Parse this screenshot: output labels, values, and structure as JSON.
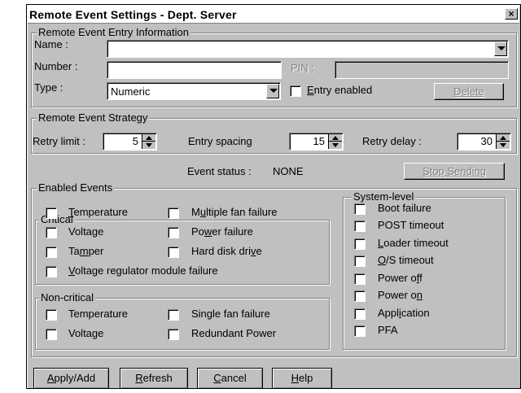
{
  "window": {
    "title": "Remote Event Settings - Dept. Server",
    "close_glyph": "×"
  },
  "entry": {
    "group_title": "Remote Event Entry Information",
    "name_label": "Name :",
    "name_value": "",
    "number_label": "Number :",
    "number_value": "",
    "pin_label": "PIN :",
    "pin_value": "",
    "type_label": "Type :",
    "type_value": "Numeric",
    "entry_enabled_pre": "",
    "entry_enabled_mn": "E",
    "entry_enabled_post": "ntry enabled",
    "entry_enabled_checked": false,
    "delete_label": "Delete"
  },
  "strategy": {
    "group_title": "Remote Event Strategy",
    "retry_limit_label": "Retry limit :",
    "retry_limit_value": "5",
    "entry_spacing_label": "Entry spacing",
    "entry_spacing_value": "15",
    "retry_delay_label": "Retry delay :",
    "retry_delay_value": "30"
  },
  "status": {
    "label": "Event status :",
    "value": "NONE",
    "stop_label": "Stop Sending"
  },
  "events": {
    "group_title": "Enabled Events",
    "critical": {
      "title": "Critical",
      "temperature": {
        "pre": "",
        "mn": "T",
        "post": "emperature",
        "checked": false
      },
      "voltage": {
        "pre": "Voltage",
        "mn": "",
        "post": "",
        "checked": false
      },
      "tamper": {
        "pre": "Ta",
        "mn": "m",
        "post": "per",
        "checked": false
      },
      "multiple_fan": {
        "pre": "M",
        "mn": "u",
        "post": "ltiple fan failure",
        "checked": false
      },
      "power_failure": {
        "pre": "Po",
        "mn": "w",
        "post": "er failure",
        "checked": false
      },
      "hard_disk": {
        "pre": "Hard disk dri",
        "mn": "v",
        "post": "e",
        "checked": false
      },
      "vrm": {
        "pre": "",
        "mn": "V",
        "post": "oltage regulator module failure",
        "checked": false
      }
    },
    "non_critical": {
      "title": "Non-critical",
      "temperature": {
        "label": "Temperature",
        "checked": false
      },
      "voltage": {
        "label": "Voltage",
        "checked": false
      },
      "single_fan": {
        "label": "Single fan failure",
        "checked": false
      },
      "redundant_power": {
        "label": "Redundant Power",
        "checked": false
      }
    },
    "system_level": {
      "title": "System-level",
      "boot_failure": {
        "pre": "Boot failure",
        "mn": "",
        "post": "",
        "checked": false
      },
      "post_timeout": {
        "pre": "POST timeout",
        "mn": "",
        "post": "",
        "checked": false
      },
      "loader_timeout": {
        "pre": "",
        "mn": "L",
        "post": "oader timeout",
        "checked": false
      },
      "os_timeout": {
        "pre": "",
        "mn": "O",
        "post": "/S timeout",
        "checked": false
      },
      "power_off": {
        "pre": "Power o",
        "mn": "f",
        "post": "f",
        "checked": false
      },
      "power_on": {
        "pre": "Power o",
        "mn": "n",
        "post": "",
        "checked": false
      },
      "application": {
        "pre": "Appl",
        "mn": "i",
        "post": "cation",
        "checked": false
      },
      "pfa": {
        "pre": "PFA",
        "mn": "",
        "post": "",
        "checked": false
      }
    }
  },
  "buttons": {
    "apply": {
      "pre": "",
      "mn": "A",
      "post": "pply/Add"
    },
    "refresh": {
      "pre": "",
      "mn": "R",
      "post": "efresh"
    },
    "cancel": {
      "pre": "",
      "mn": "C",
      "post": "ancel"
    },
    "help": {
      "pre": "",
      "mn": "H",
      "post": "elp"
    }
  },
  "colors": {
    "face": "#c0c0c0",
    "shadow": "#808080",
    "highlight": "#ffffff",
    "field": "#ffffff"
  }
}
